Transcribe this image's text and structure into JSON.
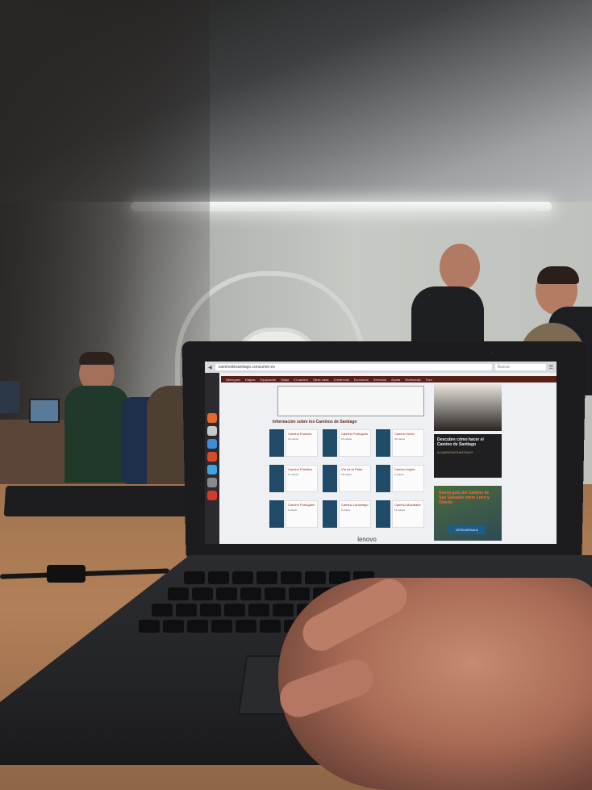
{
  "browser": {
    "url": "caminodesantiago.consumer.es",
    "search_placeholder": "Buscar"
  },
  "site": {
    "nav": [
      "Albergues",
      "Etapas",
      "Equipación",
      "Mapa",
      "El camino",
      "Otras rutas",
      "Credencial",
      "Economía",
      "Servicios",
      "Ayuda",
      "Multimedia",
      "Foro"
    ],
    "section_title": "Información sobre los Caminos de Santiago",
    "cards": [
      {
        "title": "Camino Francés",
        "meta": "34 etapas"
      },
      {
        "title": "Camino Portugués",
        "meta": "25 etapas"
      },
      {
        "title": "Camino Norte",
        "meta": "34 etapas"
      },
      {
        "title": "Camino Primitivo",
        "meta": "14 etapas"
      },
      {
        "title": "Vía de la Plata",
        "meta": "38 etapas"
      },
      {
        "title": "Camino Inglés",
        "meta": "6 etapas"
      },
      {
        "title": "Camino Portugués",
        "meta": "9 etapas"
      },
      {
        "title": "Camino Lebaniego",
        "meta": "8 etapas"
      },
      {
        "title": "Camino Mozárabe",
        "meta": "14 etapas"
      }
    ],
    "side_promo": "Descubre cómo hacer el Camino de Santiago",
    "side_link": "#CAMINODESANTIAGO",
    "ad_text": "Nueva guía del Camino de San Salvador entre León y Oviedo",
    "ad_button": "DESCARGALA"
  },
  "laptop": {
    "brand": "lenovo"
  },
  "colors": {
    "site_nav": "#5a1f19",
    "card_image": "#1f4a68",
    "ad_button": "#1b5d8c"
  }
}
